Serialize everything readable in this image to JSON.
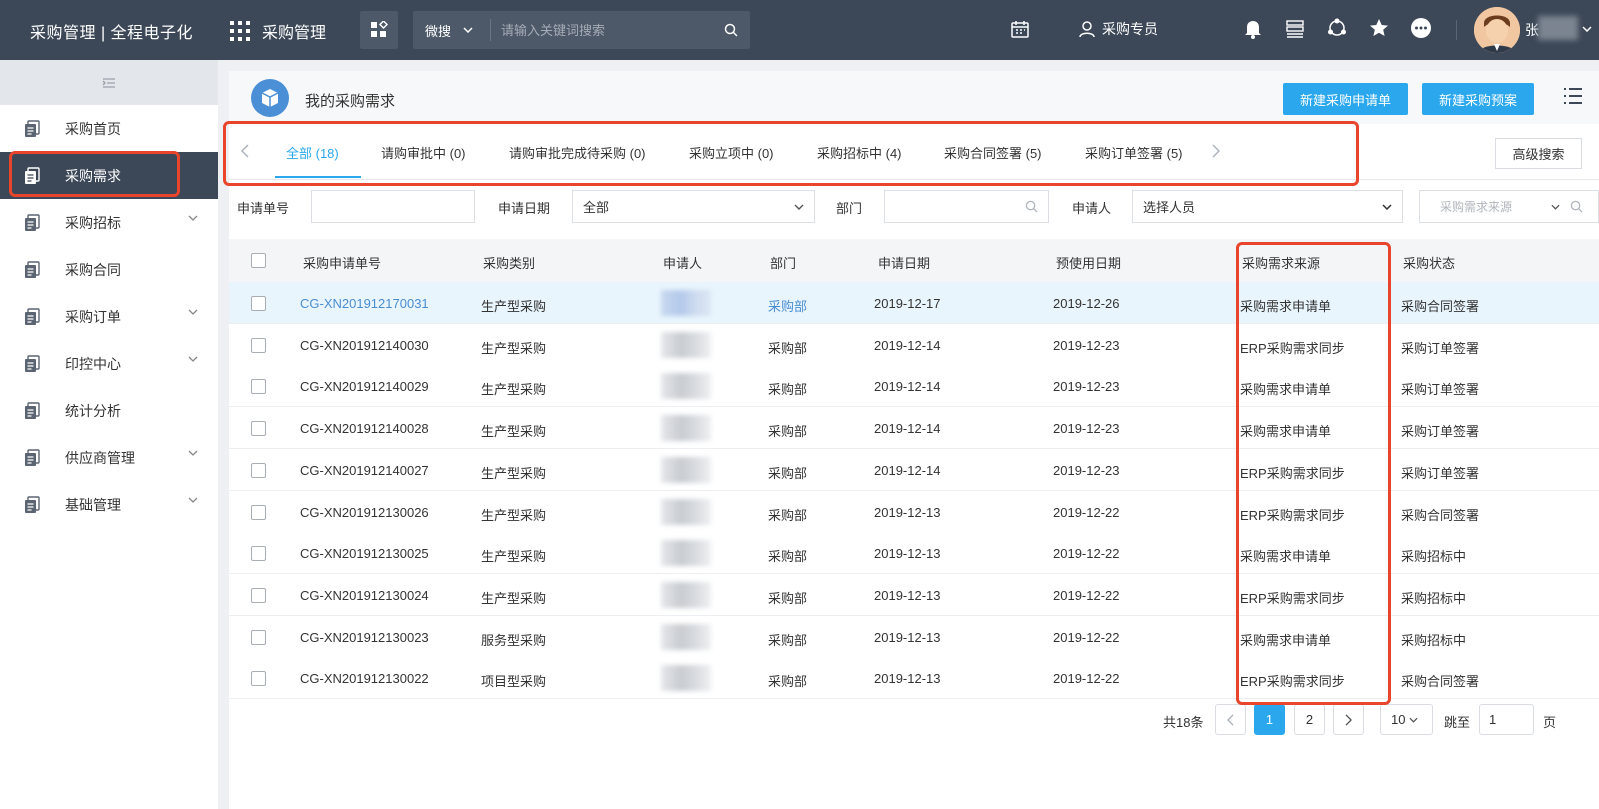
{
  "header": {
    "brand": "采购管理 | 全程电子化",
    "app_name": "采购管理",
    "search_type": "微搜",
    "search_placeholder": "请输入关键词搜索",
    "role": "采购专员",
    "username_initial": "张"
  },
  "sidebar": {
    "items": [
      {
        "label": "采购首页",
        "has_children": false,
        "active": false
      },
      {
        "label": "采购需求",
        "has_children": false,
        "active": true
      },
      {
        "label": "采购招标",
        "has_children": true,
        "active": false
      },
      {
        "label": "采购合同",
        "has_children": false,
        "active": false
      },
      {
        "label": "采购订单",
        "has_children": true,
        "active": false
      },
      {
        "label": "印控中心",
        "has_children": true,
        "active": false
      },
      {
        "label": "统计分析",
        "has_children": false,
        "active": false
      },
      {
        "label": "供应商管理",
        "has_children": true,
        "active": false
      },
      {
        "label": "基础管理",
        "has_children": true,
        "active": false
      }
    ]
  },
  "page": {
    "title": "我的采购需求",
    "btn_new_request": "新建采购申请单",
    "btn_new_plan": "新建采购预案",
    "btn_advanced": "高级搜索"
  },
  "tabs": [
    {
      "label": "全部 (18)",
      "active": true
    },
    {
      "label": "请购审批中 (0)",
      "active": false
    },
    {
      "label": "请购审批完成待采购 (0)",
      "active": false
    },
    {
      "label": "采购立项中 (0)",
      "active": false
    },
    {
      "label": "采购招标中 (4)",
      "active": false
    },
    {
      "label": "采购合同签署 (5)",
      "active": false
    },
    {
      "label": "采购订单签署 (5)",
      "active": false
    }
  ],
  "filters": {
    "order_no_label": "申请单号",
    "date_label": "申请日期",
    "date_value": "全部",
    "dept_label": "部门",
    "applicant_label": "申请人",
    "applicant_value": "选择人员",
    "source_placeholder": "采购需求来源"
  },
  "table": {
    "columns": [
      "采购申请单号",
      "采购类别",
      "申请人",
      "部门",
      "申请日期",
      "预使用日期",
      "采购需求来源",
      "采购状态"
    ],
    "rows": [
      {
        "no": "CG-XN201912170031",
        "category": "生产型采购",
        "dept": "采购部",
        "date": "2019-12-17",
        "use_date": "2019-12-26",
        "source": "采购需求申请单",
        "status": "采购合同签署"
      },
      {
        "no": "CG-XN201912140030",
        "category": "生产型采购",
        "dept": "采购部",
        "date": "2019-12-14",
        "use_date": "2019-12-23",
        "source": "ERP采购需求同步",
        "status": "采购订单签署"
      },
      {
        "no": "CG-XN201912140029",
        "category": "生产型采购",
        "dept": "采购部",
        "date": "2019-12-14",
        "use_date": "2019-12-23",
        "source": "采购需求申请单",
        "status": "采购订单签署"
      },
      {
        "no": "CG-XN201912140028",
        "category": "生产型采购",
        "dept": "采购部",
        "date": "2019-12-14",
        "use_date": "2019-12-23",
        "source": "采购需求申请单",
        "status": "采购订单签署"
      },
      {
        "no": "CG-XN201912140027",
        "category": "生产型采购",
        "dept": "采购部",
        "date": "2019-12-14",
        "use_date": "2019-12-23",
        "source": "ERP采购需求同步",
        "status": "采购订单签署"
      },
      {
        "no": "CG-XN201912130026",
        "category": "生产型采购",
        "dept": "采购部",
        "date": "2019-12-13",
        "use_date": "2019-12-22",
        "source": "ERP采购需求同步",
        "status": "采购合同签署"
      },
      {
        "no": "CG-XN201912130025",
        "category": "生产型采购",
        "dept": "采购部",
        "date": "2019-12-13",
        "use_date": "2019-12-22",
        "source": "采购需求申请单",
        "status": "采购招标中"
      },
      {
        "no": "CG-XN201912130024",
        "category": "生产型采购",
        "dept": "采购部",
        "date": "2019-12-13",
        "use_date": "2019-12-22",
        "source": "ERP采购需求同步",
        "status": "采购招标中"
      },
      {
        "no": "CG-XN201912130023",
        "category": "服务型采购",
        "dept": "采购部",
        "date": "2019-12-13",
        "use_date": "2019-12-22",
        "source": "采购需求申请单",
        "status": "采购招标中"
      },
      {
        "no": "CG-XN201912130022",
        "category": "项目型采购",
        "dept": "采购部",
        "date": "2019-12-13",
        "use_date": "2019-12-22",
        "source": "ERP采购需求同步",
        "status": "采购合同签署"
      }
    ]
  },
  "pagination": {
    "total": "共18条",
    "pages": [
      "1",
      "2"
    ],
    "current": "1",
    "page_size": "10",
    "jump_label": "跳至",
    "jump_value": "1",
    "page_unit": "页"
  },
  "colors": {
    "topbar": "#3c4757",
    "accent": "#2ba8ed",
    "highlight": "#e8452c",
    "link": "#4a8ed2"
  },
  "icons": [
    "apps-grid-icon",
    "tile-icon",
    "search-icon",
    "chevron-down-icon",
    "calendar-icon",
    "user-icon",
    "bell-icon",
    "server-icon",
    "share-icon",
    "star-icon",
    "more-icon",
    "document-icon",
    "list-icon",
    "cube-icon",
    "chevron-left-icon",
    "chevron-right-icon",
    "collapse-icon"
  ]
}
